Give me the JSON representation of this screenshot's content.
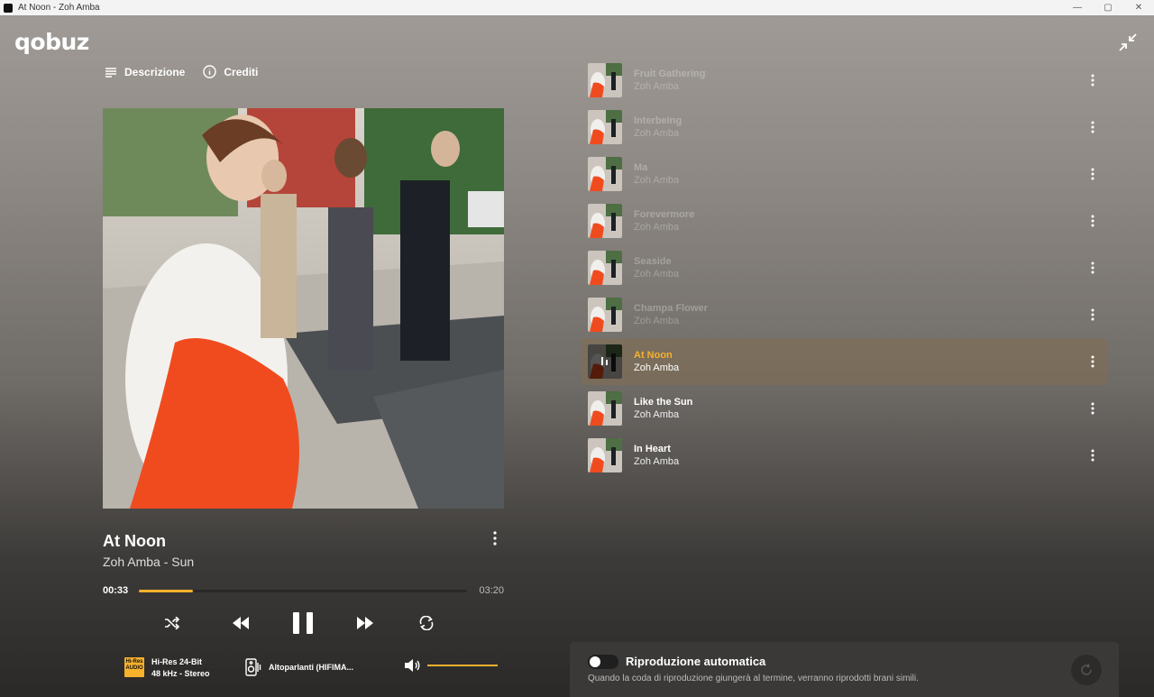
{
  "window": {
    "title": "At Noon - Zoh Amba",
    "min_glyph": "—",
    "max_glyph": "▢",
    "close_glyph": "✕"
  },
  "app": {
    "logo_text": "qobuz"
  },
  "tabs": [
    {
      "label": "Descrizione",
      "icon": "lines-icon"
    },
    {
      "label": "Crediti",
      "icon": "info-icon"
    }
  ],
  "now_playing": {
    "title": "At Noon",
    "subtitle": "Zoh Amba - Sun",
    "time_current": "00:33",
    "time_total": "03:20",
    "progress": 0.165
  },
  "quality": {
    "badge_line1": "Hi-Res",
    "badge_line2": "AUDIO",
    "line1": "Hi-Res 24-Bit",
    "line2": "48 kHz - Stereo"
  },
  "output": {
    "device": "Altoparlanti (HIFIMA..."
  },
  "volume": {
    "level": 1.0
  },
  "queue": [
    {
      "title": "Fruit Gathering",
      "artist": "Zoh Amba",
      "state": "past"
    },
    {
      "title": "Interbeing",
      "artist": "Zoh Amba",
      "state": "past"
    },
    {
      "title": "Ma",
      "artist": "Zoh Amba",
      "state": "past"
    },
    {
      "title": "Forevermore",
      "artist": "Zoh Amba",
      "state": "past"
    },
    {
      "title": "Seaside",
      "artist": "Zoh Amba",
      "state": "past"
    },
    {
      "title": "Champa Flower",
      "artist": "Zoh Amba",
      "state": "past"
    },
    {
      "title": "At Noon",
      "artist": "Zoh Amba",
      "state": "active"
    },
    {
      "title": "Like the Sun",
      "artist": "Zoh Amba",
      "state": "future"
    },
    {
      "title": "In Heart",
      "artist": "Zoh Amba",
      "state": "future"
    }
  ],
  "autoplay": {
    "title": "Riproduzione automatica",
    "description": "Quando la coda di riproduzione giungerà al termine, verranno riprodotti brani simili.",
    "enabled": false
  },
  "colors": {
    "accent": "#f7b12c",
    "bg_top": "#a19c97",
    "bg_bottom": "#2a2928",
    "panel": "#3a3938"
  }
}
